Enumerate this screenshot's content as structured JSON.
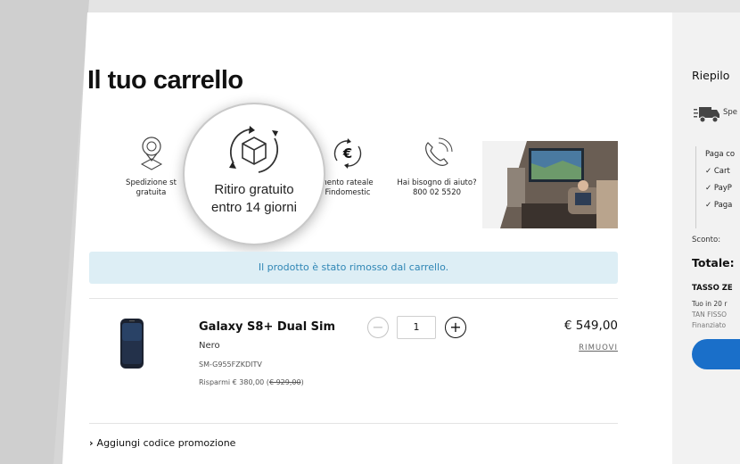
{
  "page": {
    "title": "Il tuo carrello"
  },
  "features": {
    "shipping": {
      "line1": "Spedizione st",
      "line2": "gratuita",
      "icon": "delivery-pin-icon"
    },
    "pickup": {
      "line1": "Ritiro gratuito",
      "line2": "entro 14 giorni",
      "icon": "box-return-icon"
    },
    "installments": {
      "line1": "nento rateale",
      "line2": "Findomestic",
      "icon": "euro-cycle-icon"
    },
    "help": {
      "line1": "Hai bisogno di aiuto?",
      "line2": "800 02 5520",
      "icon": "phone-icon"
    }
  },
  "alert": {
    "message": "Il prodotto è stato rimosso dal carrello."
  },
  "cart_item": {
    "name": "Galaxy S8+ Dual Sim",
    "color": "Nero",
    "sku": "SM-G955FZKDITV",
    "savings_label": "Risparmi € 380,00 (",
    "old_price": "€ 929,00",
    "savings_close": ")",
    "quantity": "1",
    "minus": "−",
    "plus": "+",
    "price": "€ 549,00",
    "remove": "RIMUOVI"
  },
  "promo": {
    "chevron": "›",
    "label": "Aggiungi codice promozione"
  },
  "summary": {
    "title": "Riepilo",
    "shipping": "Spe",
    "pay_header": "Paga co",
    "pay_options": [
      "✓ Cart",
      "✓ PayP",
      "✓ Paga"
    ],
    "discount_label": "Sconto:",
    "total_label": "Totale:",
    "tasso": "TASSO ZE",
    "fin_lines": [
      "Tuo in 20 r",
      "TAN FISSO",
      "Finanziato"
    ]
  },
  "colors": {
    "accent_blue": "#1a6fc9",
    "alert_bg": "#ddeef5",
    "alert_text": "#2f86b5"
  }
}
